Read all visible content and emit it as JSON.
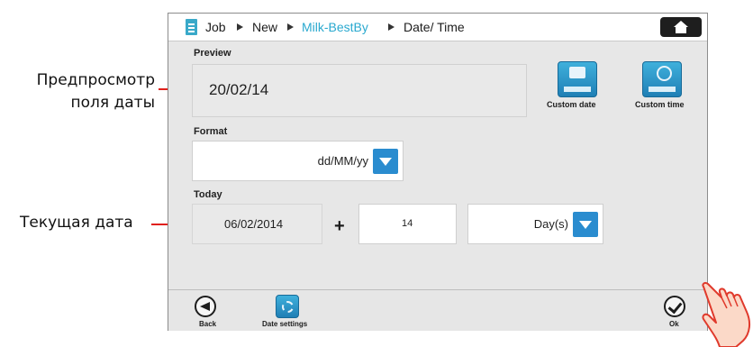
{
  "annotations": {
    "preview": [
      "Предпросмотр",
      "поля даты"
    ],
    "today": "Текущая дата"
  },
  "header": {
    "crumbs": [
      "Job",
      "New",
      "Milk-BestBy",
      "Date/ Time"
    ]
  },
  "preview": {
    "label": "Preview",
    "value": "20/02/14"
  },
  "custom_buttons": {
    "date": "Custom date",
    "time": "Custom time"
  },
  "format": {
    "label": "Format",
    "value": "dd/MM/yy"
  },
  "today": {
    "label": "Today",
    "date": "06/02/2014",
    "operator": "+",
    "offset": "14",
    "unit": "Day(s)"
  },
  "bottom": {
    "back": "Back",
    "date_settings": "Date settings",
    "ok": "Ok"
  },
  "colors": {
    "accent": "#2a8ccf",
    "highlight": "#2aa9cf",
    "annotation": "#e0201b"
  },
  "icons": [
    "document-icon",
    "home-icon",
    "calendar-icon",
    "clock-icon",
    "chevron-down-icon",
    "back-icon",
    "gear-icon",
    "check-icon",
    "pointing-hand-icon"
  ]
}
